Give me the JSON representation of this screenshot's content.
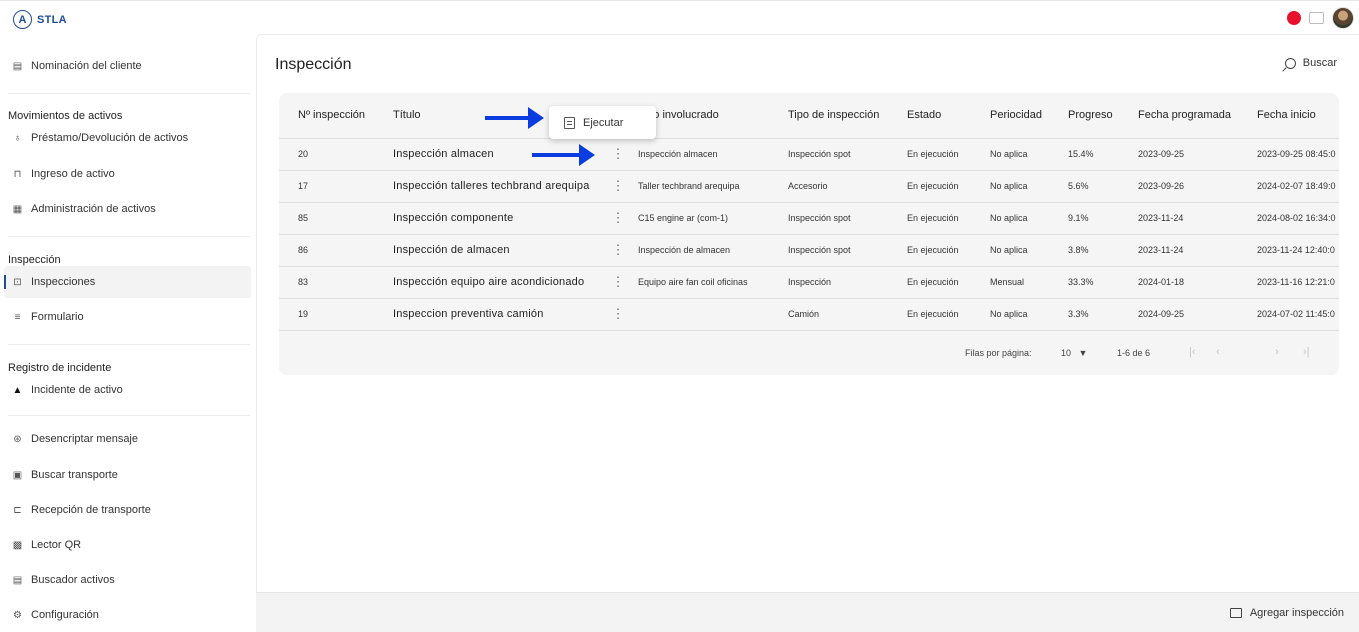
{
  "app": {
    "logo_letter": "A",
    "name": "STLA"
  },
  "sidebar": {
    "nomination": "Nominación del cliente",
    "sections": {
      "movimientos": "Movimientos de activos",
      "inspeccion": "Inspección",
      "registro": "Registro de incidente"
    },
    "items": {
      "prestamo": "Préstamo/Devolución de activos",
      "ingreso": "Ingreso de activo",
      "administracion": "Administración de activos",
      "inspecciones": "Inspecciones",
      "formulario": "Formulario",
      "incidente": "Incidente de activo",
      "desencriptar": "Desencriptar mensaje",
      "buscar_transporte": "Buscar transporte",
      "recepcion": "Recepción de transporte",
      "lector": "Lector QR",
      "buscador": "Buscador activos",
      "configuracion": "Configuración"
    }
  },
  "main": {
    "title": "Inspección",
    "search_label": "Buscar",
    "columns": [
      "Nº inspección",
      "Título",
      "",
      "urso involucrado",
      "Tipo de inspección",
      "Estado",
      "Periocidad",
      "Progreso",
      "Fecha programada",
      "Fecha inicio"
    ],
    "rows": [
      [
        "20",
        "Inspección almacen",
        "Inspección almacen",
        "Inspección spot",
        "En ejecución",
        "No aplica",
        "15.4%",
        "2023-09-25",
        "2023-09-25 08:45:0"
      ],
      [
        "17",
        "Inspección talleres techbrand arequipa",
        "Taller techbrand arequipa",
        "Accesorio",
        "En ejecución",
        "No aplica",
        "5.6%",
        "2023-09-26",
        "2024-02-07 18:49:0"
      ],
      [
        "85",
        "Inspección componente",
        "C15 engine ar (com-1)",
        "Inspección spot",
        "En ejecución",
        "No aplica",
        "9.1%",
        "2023-11-24",
        "2024-08-02 16:34:0"
      ],
      [
        "86",
        "Inspección de almacen",
        "Inspección de almacen",
        "Inspección spot",
        "En ejecución",
        "No aplica",
        "3.8%",
        "2023-11-24",
        "2023-11-24 12:40:0"
      ],
      [
        "83",
        "Inspección equipo aire acondicionado",
        "Equipo aire fan coil oficinas",
        "Inspección",
        "En ejecución",
        "Mensual",
        "33.3%",
        "2024-01-18",
        "2023-11-16 12:21:0"
      ],
      [
        "19",
        "Inspeccion preventiva camión",
        "",
        "Camión",
        "En ejecución",
        "No aplica",
        "3.3%",
        "2024-09-25",
        "2024-07-02 11:45:0"
      ]
    ],
    "pager": {
      "rows_label": "Filas por página:",
      "rows_value": "10",
      "range": "1-6 de 6"
    },
    "menu": {
      "execute_label": "Ejecutar"
    }
  },
  "footer": {
    "add_label": "Agregar inspección"
  },
  "colors": {
    "accent": "#1e4c9a",
    "arrow": "#0a3ce0",
    "record": "#e8102a"
  }
}
